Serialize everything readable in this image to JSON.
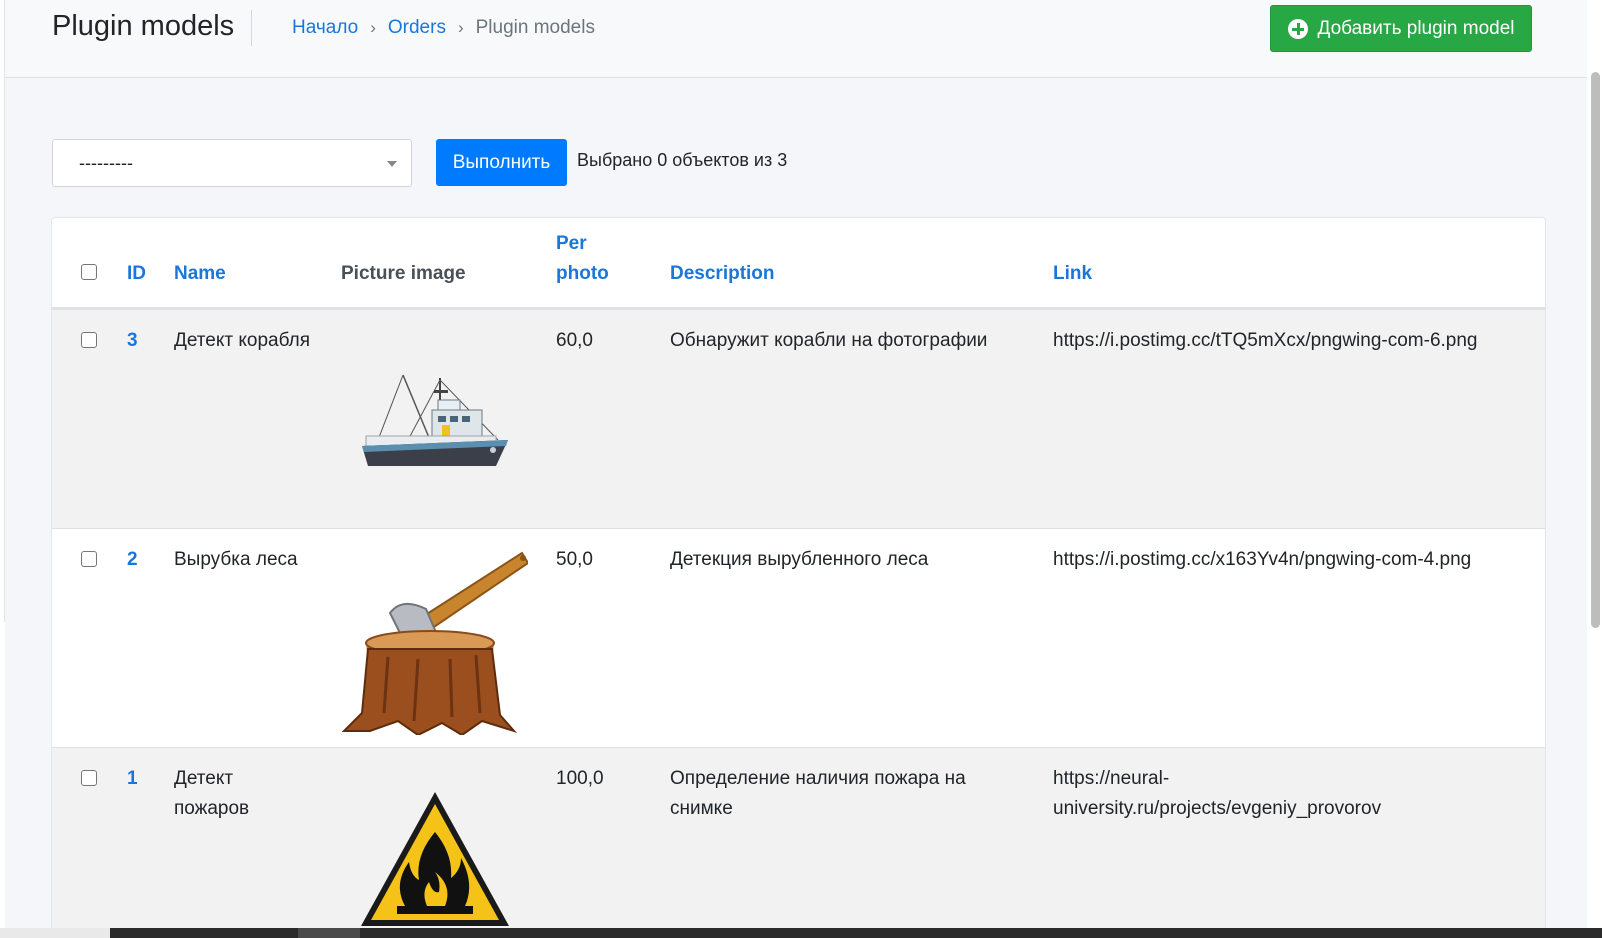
{
  "header": {
    "title": "Plugin models",
    "breadcrumb": {
      "home": "Начало",
      "app": "Orders",
      "current": "Plugin models",
      "separator": "›"
    },
    "add_button_label": "Добавить plugin model"
  },
  "actions": {
    "select_value": "---------",
    "run_label": "Выполнить",
    "selected_text": "Выбрано 0 объектов из 3"
  },
  "table": {
    "columns": {
      "id": "ID",
      "name": "Name",
      "picture": "Picture image",
      "per_photo_line1": "Per",
      "per_photo_line2": "photo",
      "description": "Description",
      "link": "Link"
    },
    "rows": [
      {
        "id": "3",
        "name": "Детект корабля",
        "picture": "ship-image",
        "per_photo": "60,0",
        "description": "Обнаружит корабли на фотографии",
        "link": "https://i.postimg.cc/tTQ5mXcx/pngwing-com-6.png"
      },
      {
        "id": "2",
        "name": "Вырубка леса",
        "picture": "axe-stump-image",
        "per_photo": "50,0",
        "description": "Детекция вырубленного леса",
        "link": "https://i.postimg.cc/x163Yv4n/pngwing-com-4.png"
      },
      {
        "id": "1",
        "name_line1": "Детект",
        "name_line2": "пожаров",
        "picture": "fire-warning-image",
        "per_photo": "100,0",
        "description_line1": "Определение наличия пожара на",
        "description_line2": "снимке",
        "link_line1": "https://neural-",
        "link_line2": "university.ru/projects/evgeniy_provorov"
      }
    ]
  },
  "colors": {
    "primary": "#007bff",
    "success": "#28a745",
    "link": "#1a76d9"
  }
}
